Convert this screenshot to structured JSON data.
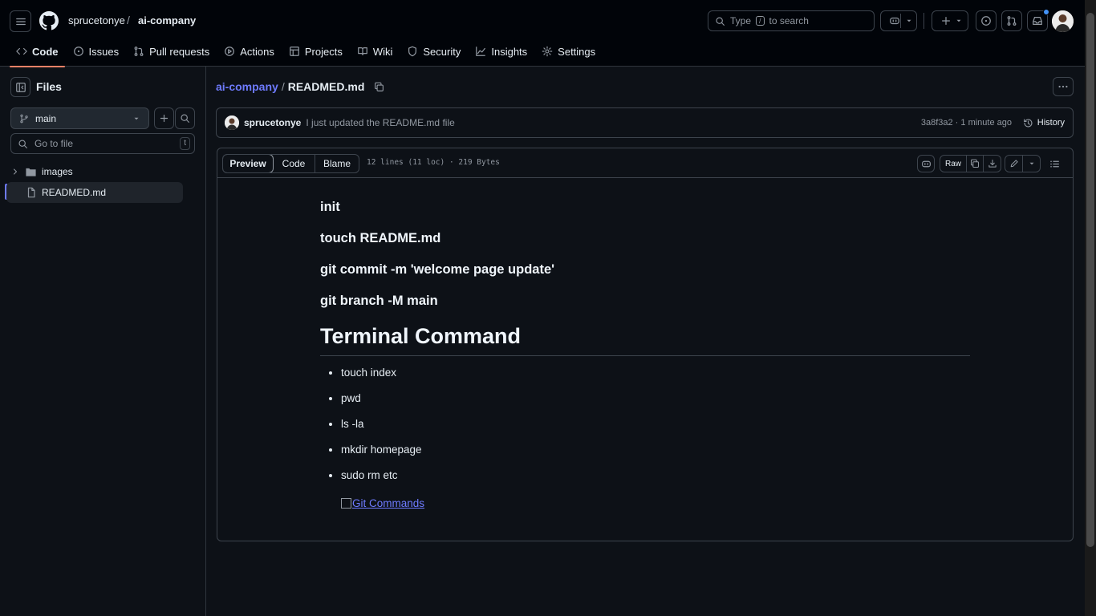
{
  "header": {
    "owner": "sprucetonye",
    "slash": "/",
    "repo": "ai-company",
    "search_before": "Type",
    "search_key": "/",
    "search_after": "to search"
  },
  "repo_tabs": [
    {
      "label": "Code",
      "icon": "code-icon",
      "active": true
    },
    {
      "label": "Issues",
      "icon": "issue-icon"
    },
    {
      "label": "Pull requests",
      "icon": "pull-request-icon"
    },
    {
      "label": "Actions",
      "icon": "play-icon"
    },
    {
      "label": "Projects",
      "icon": "table-icon"
    },
    {
      "label": "Wiki",
      "icon": "book-icon"
    },
    {
      "label": "Security",
      "icon": "shield-icon"
    },
    {
      "label": "Insights",
      "icon": "graph-icon"
    },
    {
      "label": "Settings",
      "icon": "gear-icon"
    }
  ],
  "sidebar": {
    "title": "Files",
    "branch": "main",
    "goto_placeholder": "Go to file",
    "goto_key": "t",
    "tree": [
      {
        "label": "images",
        "type": "folder"
      },
      {
        "label": "READMED.md",
        "type": "file",
        "selected": true
      }
    ]
  },
  "file": {
    "path_repo": "ai-company",
    "path_sep": "/",
    "path_file": "READMED.md",
    "commit_user": "sprucetonye",
    "commit_message": "I just updated the README.md file",
    "commit_meta": "3a8f3a2 · 1 minute ago",
    "history_label": "History",
    "view_tabs": [
      "Preview",
      "Code",
      "Blame"
    ],
    "stats": "12 lines (11 loc) · 219 Bytes",
    "raw_label": "Raw"
  },
  "readme": {
    "headings": [
      "init",
      "touch README.md",
      "git commit -m 'welcome page update'",
      "git branch -M main"
    ],
    "title": "Terminal Command",
    "items": [
      "touch index",
      "pwd",
      "ls -la",
      "mkdir homepage",
      "sudo rm etc"
    ],
    "image_alt": "Git Commands"
  },
  "colors": {
    "background": "#0d1117",
    "header": "#010409",
    "border": "#3d444d",
    "link": "#6e7bff",
    "active_tab_underline": "#f78166"
  }
}
